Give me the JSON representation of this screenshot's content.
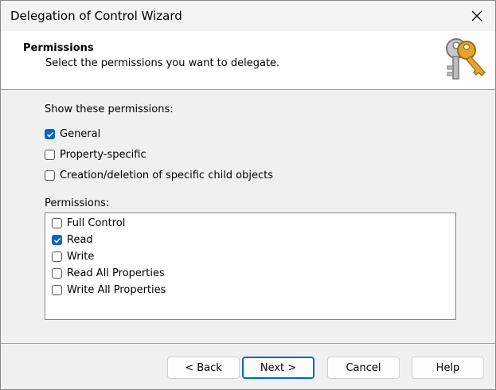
{
  "window": {
    "title": "Delegation of Control Wizard"
  },
  "header": {
    "title": "Permissions",
    "subtitle": "Select the permissions you want to delegate.",
    "icon": "keys-icon"
  },
  "show_permissions": {
    "label": "Show these permissions:",
    "options": [
      {
        "label": "General",
        "checked": true
      },
      {
        "label": "Property-specific",
        "checked": false
      },
      {
        "label": "Creation/deletion of specific child objects",
        "checked": false
      }
    ]
  },
  "permissions": {
    "label": "Permissions:",
    "items": [
      {
        "label": "Full Control",
        "checked": false
      },
      {
        "label": "Read",
        "checked": true
      },
      {
        "label": "Write",
        "checked": false
      },
      {
        "label": "Read All Properties",
        "checked": false
      },
      {
        "label": "Write All Properties",
        "checked": false
      }
    ]
  },
  "buttons": {
    "back": "< Back",
    "next": "Next >",
    "cancel": "Cancel",
    "help": "Help"
  },
  "colors": {
    "accent": "#0a64c2",
    "header_bg": "#ffffff",
    "dialog_bg": "#f0f0f0"
  }
}
